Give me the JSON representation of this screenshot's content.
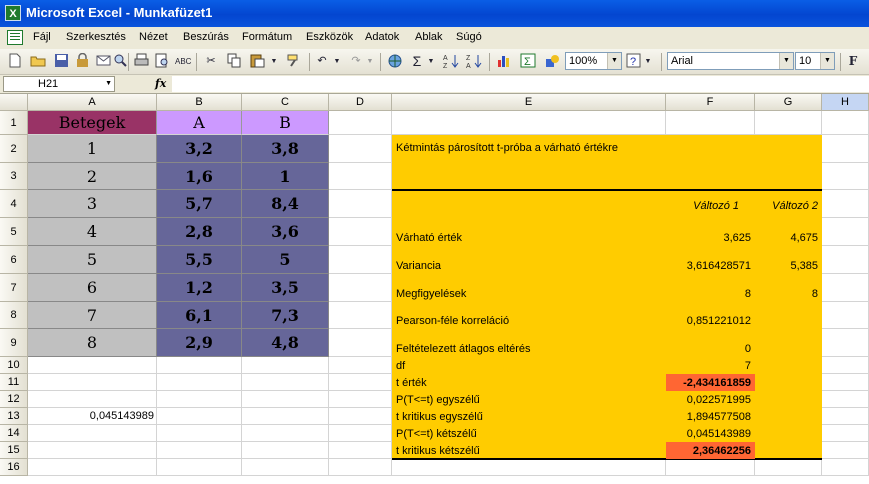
{
  "window": {
    "title": "Microsoft Excel - Munkafüzet1",
    "app_icon": "excel-icon"
  },
  "menu": [
    "Fájl",
    "Szerkesztés",
    "Nézet",
    "Beszúrás",
    "Formátum",
    "Eszközök",
    "Adatok",
    "Ablak",
    "Súgó"
  ],
  "toolbar": {
    "zoom": "100%",
    "font": "Arial",
    "size": "10",
    "sum_symbol": "Σ",
    "bold_label": "F"
  },
  "formula_bar": {
    "name_box": "H21",
    "fx": "fx",
    "content": ""
  },
  "columns": [
    "A",
    "B",
    "C",
    "D",
    "E",
    "F",
    "G",
    "H"
  ],
  "rows": [
    "1",
    "2",
    "3",
    "4",
    "5",
    "6",
    "7",
    "8",
    "9",
    "10",
    "11",
    "12",
    "13",
    "14",
    "15",
    "16"
  ],
  "colors": {
    "header_left": "#993366",
    "header_ab": "#cc99ff",
    "data_gray": "#c0c0c0",
    "data_blue": "#666699",
    "result_bg": "#ffcc00",
    "highlight": "#ff6633"
  },
  "data_table": {
    "header": [
      "Betegek",
      "A",
      "B"
    ],
    "rows": [
      [
        "1",
        "3,2",
        "3,8"
      ],
      [
        "2",
        "1,6",
        "1"
      ],
      [
        "3",
        "5,7",
        "8,4"
      ],
      [
        "4",
        "2,8",
        "3,6"
      ],
      [
        "5",
        "5,5",
        "5"
      ],
      [
        "6",
        "1,2",
        "3,5"
      ],
      [
        "7",
        "6,1",
        "7,3"
      ],
      [
        "8",
        "2,9",
        "4,8"
      ]
    ]
  },
  "a13_value": "0,045143989",
  "ttest": {
    "title": "Kétmintás párosított t-próba a várható értékre",
    "col_f": "Változó 1",
    "col_g": "Változó 2",
    "rows": [
      {
        "label": "Várható érték",
        "f": "3,625",
        "g": "4,675"
      },
      {
        "label": "Variancia",
        "f": "3,616428571",
        "g": "5,385"
      },
      {
        "label": "Megfigyelések",
        "f": "8",
        "g": "8"
      },
      {
        "label": "Pearson-féle korreláció",
        "f": "0,851221012",
        "g": ""
      },
      {
        "label": "Feltételezett átlagos eltérés",
        "f": "0",
        "g": ""
      },
      {
        "label": "df",
        "f": "7",
        "g": ""
      },
      {
        "label": "t érték",
        "f": "-2,434161859",
        "g": ""
      },
      {
        "label": "P(T<=t) egyszélű",
        "f": "0,022571995",
        "g": ""
      },
      {
        "label": "t kritikus egyszélű",
        "f": "1,894577508",
        "g": ""
      },
      {
        "label": "P(T<=t) kétszélű",
        "f": "0,045143989",
        "g": ""
      },
      {
        "label": "t kritikus kétszélű",
        "f": "2,36462256",
        "g": ""
      }
    ]
  }
}
